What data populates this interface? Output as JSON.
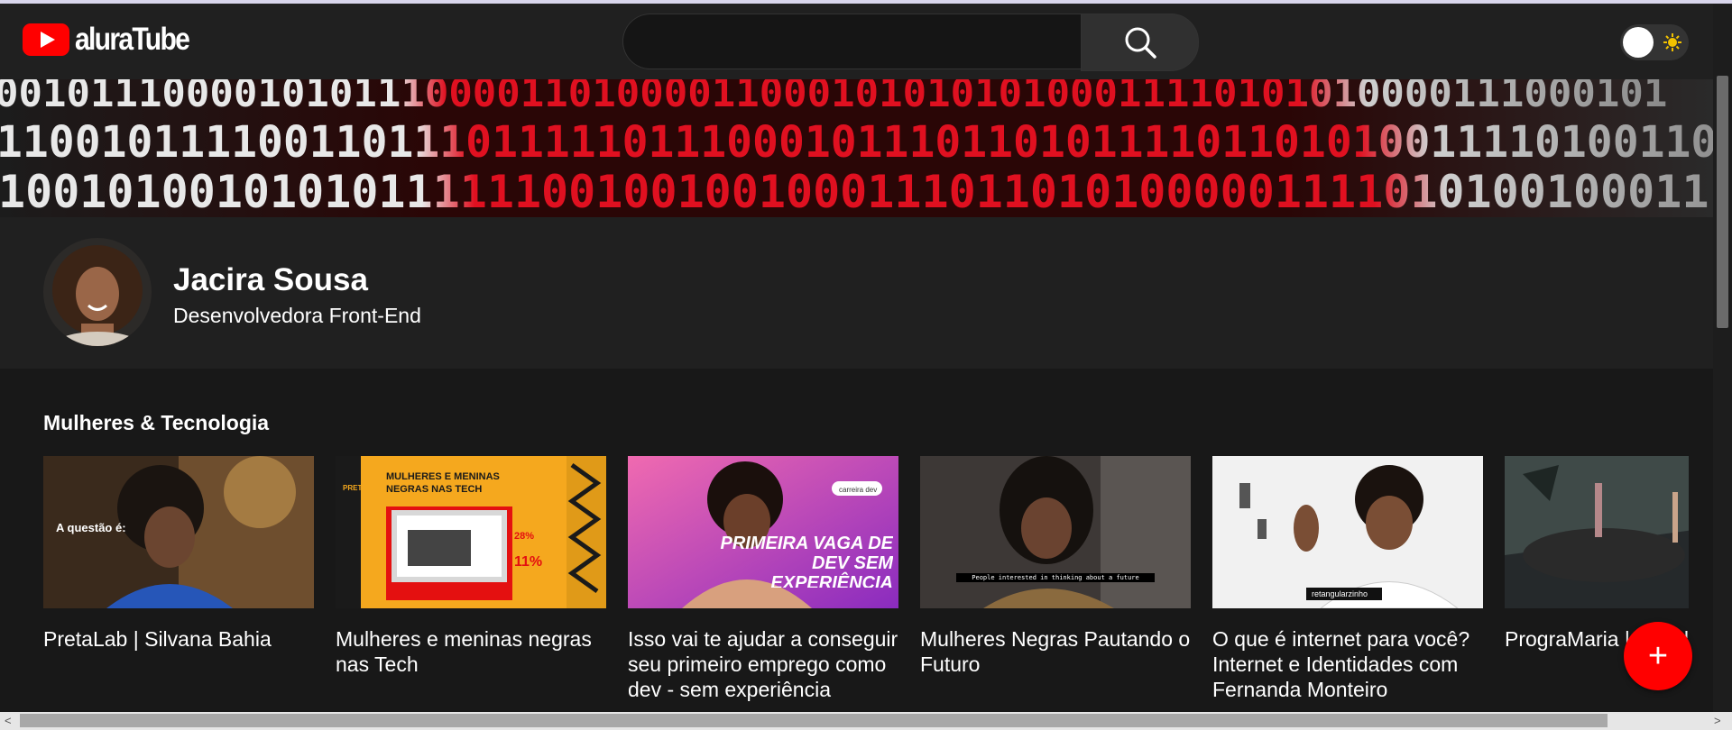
{
  "header": {
    "logo_text": "aluraTube",
    "search_placeholder": "",
    "search_icon": "search-icon",
    "theme_icon": "sun-icon"
  },
  "banner": {
    "rows": [
      "0010111000010101110000110100001100010101010100011110101010000111000101",
      "1100101111001101110111110111000101110110101111011010100111101001100",
      "10010100101010111111001001001000111011010100000111101010010001111"
    ]
  },
  "profile": {
    "name": "Jacira Sousa",
    "role": "Desenvolvedora Front-End"
  },
  "section": {
    "title": "Mulheres & Tecnologia"
  },
  "videos": [
    {
      "title": "PretaLab | Silvana Bahia",
      "thumb_text": "A questão é:"
    },
    {
      "title": "Mulheres e meninas negras nas Tech",
      "thumb_text": "MULHERES E MENINAS NEGRAS NAS TECH",
      "thumb_brand": "PRETO",
      "thumb_stat1": "28%",
      "thumb_stat2": "11%"
    },
    {
      "title": "Isso vai te ajudar a conseguir seu primeiro emprego como dev - sem experiência",
      "thumb_text": "PRIMEIRA VAGA DE DEV SEM EXPERIÊNCIA",
      "thumb_badge": "carreira dev"
    },
    {
      "title": "Mulheres Negras Pautando o Futuro",
      "thumb_text": "People interested in thinking about a future"
    },
    {
      "title": "O que é internet para você? Internet e Identidades com Fernanda Monteiro",
      "thumb_text": "retangularzinho"
    },
    {
      "title": "PrograMaria | Decidi ser Dev"
    }
  ],
  "fab": {
    "label": "+"
  },
  "colors": {
    "background": "#181818",
    "header": "#202020",
    "accent": "#ff0000",
    "text": "#ffffff"
  }
}
